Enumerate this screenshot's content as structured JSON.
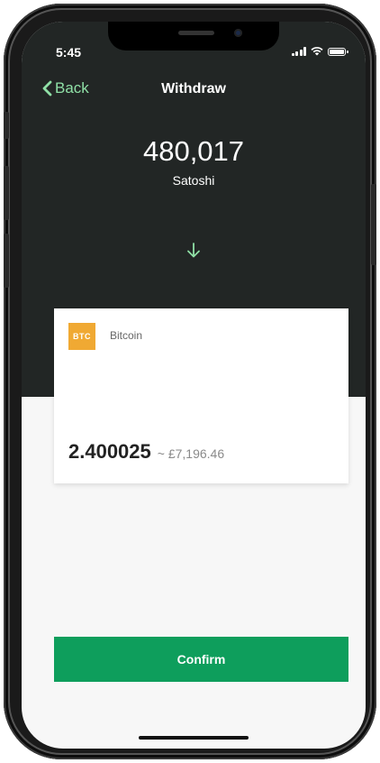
{
  "status_bar": {
    "time": "5:45"
  },
  "nav": {
    "back_label": "Back",
    "title": "Withdraw"
  },
  "amount": {
    "value": "480,017",
    "unit": "Satoshi"
  },
  "card": {
    "badge": "BTC",
    "coin_name": "Bitcoin",
    "coin_amount": "2.400025",
    "fiat_amount": "~ £7,196.46"
  },
  "confirm_label": "Confirm",
  "colors": {
    "accent_green": "#0e9e5c",
    "back_green": "#8fe0a6",
    "header_dark": "#222625",
    "btc_badge": "#f0a933"
  },
  "icons": {
    "back": "chevron-left-icon",
    "arrow": "arrow-down-icon"
  }
}
